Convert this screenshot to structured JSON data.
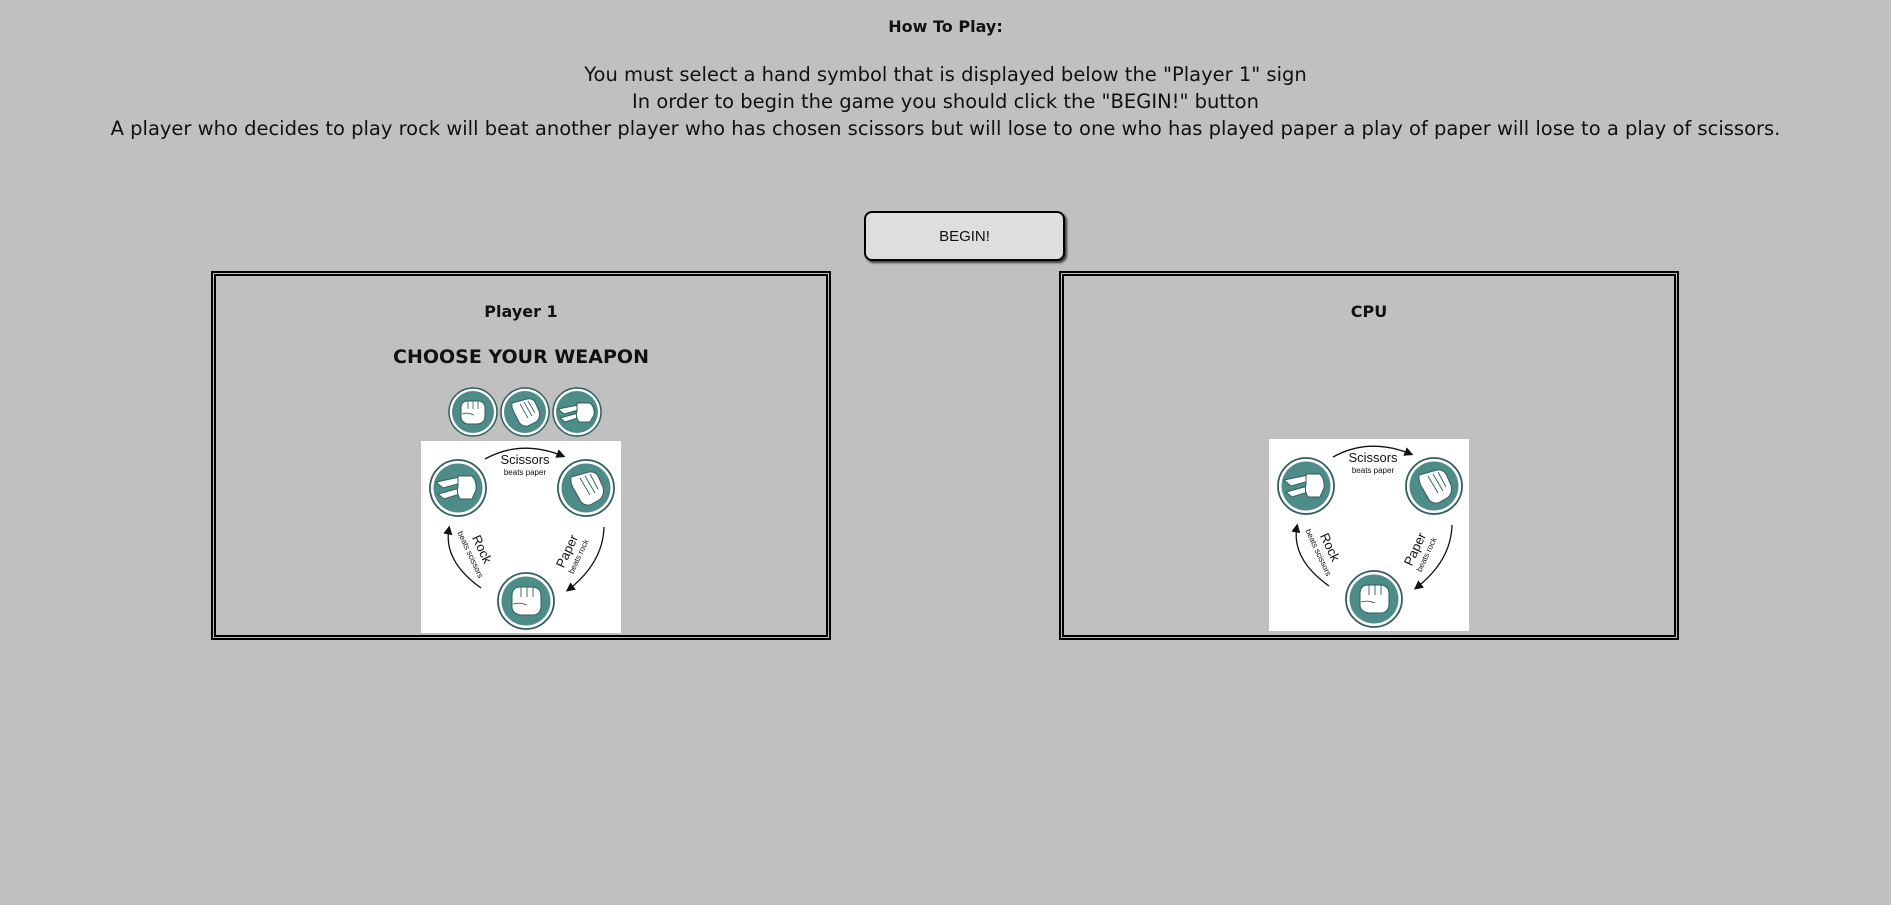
{
  "instructions": {
    "title": "How To Play:",
    "lines": [
      "You must select a hand symbol that is displayed below the \"Player 1\" sign",
      "In order to begin the game you should click the \"BEGIN!\" button",
      "A player who decides to play rock will beat another player who has chosen scissors but will lose to one who has played paper a play of paper will lose to a play of scissors."
    ]
  },
  "begin_button": {
    "label": "BEGIN!"
  },
  "player_panel": {
    "title": "Player 1",
    "subtitle": "CHOOSE YOUR WEAPON",
    "weapons": [
      {
        "name": "rock",
        "icon": "rock-hand-icon"
      },
      {
        "name": "paper",
        "icon": "paper-hand-icon"
      },
      {
        "name": "scissors",
        "icon": "scissors-hand-icon"
      }
    ]
  },
  "cpu_panel": {
    "title": "CPU"
  },
  "rules_diagram": {
    "scissors_label": "Scissors",
    "scissors_sub": "beats paper",
    "paper_label": "Paper",
    "paper_sub": "beats rock",
    "rock_label": "Rock",
    "rock_sub": "beats scissors"
  },
  "colors": {
    "background": "#c0c0c0",
    "icon_teal": "#4e8c89",
    "button_bg": "#dedede"
  }
}
